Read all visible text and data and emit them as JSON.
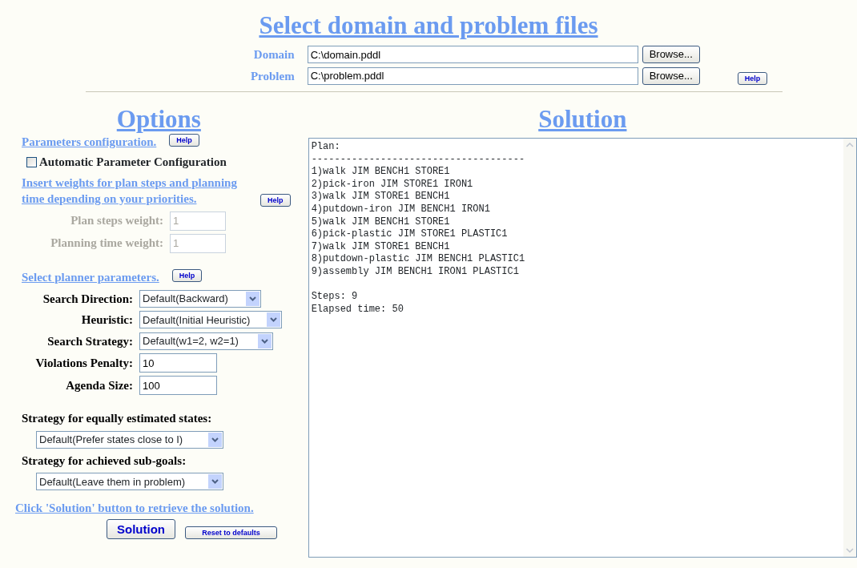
{
  "title": "Select domain and problem files",
  "files": [
    {
      "label": "Domain",
      "value": "C:\\domain.pddl",
      "button": "Browse..."
    },
    {
      "label": "Problem",
      "value": "C:\\problem.pddl",
      "button": "Browse..."
    }
  ],
  "files_help": "Help",
  "options": {
    "title": "Options",
    "parameters_link": "Parameters configuration.",
    "parameters_help": "Help",
    "auto_config": {
      "label": "Automatic Parameter Configuration",
      "checked": false
    },
    "weights_link": "Insert weights for plan steps and planning time depending on your priorities.",
    "weights_help": "Help",
    "weights": [
      {
        "label": "Plan steps weight:",
        "value": "1",
        "disabled": true
      },
      {
        "label": "Planning time weight:",
        "value": "1",
        "disabled": true
      }
    ],
    "planner_link": "Select planner parameters.",
    "planner_help": "Help",
    "parameters": [
      {
        "kind": "select",
        "label": "Search Direction:",
        "value": "Default(Backward)"
      },
      {
        "kind": "select",
        "label": "Heuristic:",
        "value": "Default(Initial Heuristic)"
      },
      {
        "kind": "select",
        "label": "Search Strategy:",
        "value": "Default(w1=2, w2=1)"
      },
      {
        "kind": "input",
        "label": "Violations Penalty:",
        "value": "10"
      },
      {
        "kind": "input",
        "label": "Agenda Size:",
        "value": "100"
      }
    ],
    "strategies": [
      {
        "label": "Strategy for equally estimated states:",
        "value": "Default(Prefer states close to I)"
      },
      {
        "label": "Strategy for achieved sub-goals:",
        "value": "Default(Leave them in problem)"
      }
    ],
    "solution_link": "Click 'Solution' button to retrieve the solution.",
    "solution_button": "Solution",
    "reset_button": "Reset to defaults"
  },
  "solution": {
    "title": "Solution",
    "lines": [
      "Plan:",
      "-------------------------------------",
      "1)walk JIM BENCH1 STORE1",
      "2)pick-iron JIM STORE1 IRON1",
      "3)walk JIM STORE1 BENCH1",
      "4)putdown-iron JIM BENCH1 IRON1",
      "5)walk JIM BENCH1 STORE1",
      "6)pick-plastic JIM STORE1 PLASTIC1",
      "7)walk JIM STORE1 BENCH1",
      "8)putdown-plastic JIM BENCH1 PLASTIC1",
      "9)assembly JIM BENCH1 IRON1 PLASTIC1"
    ],
    "summary": [
      "Steps: 9",
      "Elapsed time: 50"
    ]
  }
}
